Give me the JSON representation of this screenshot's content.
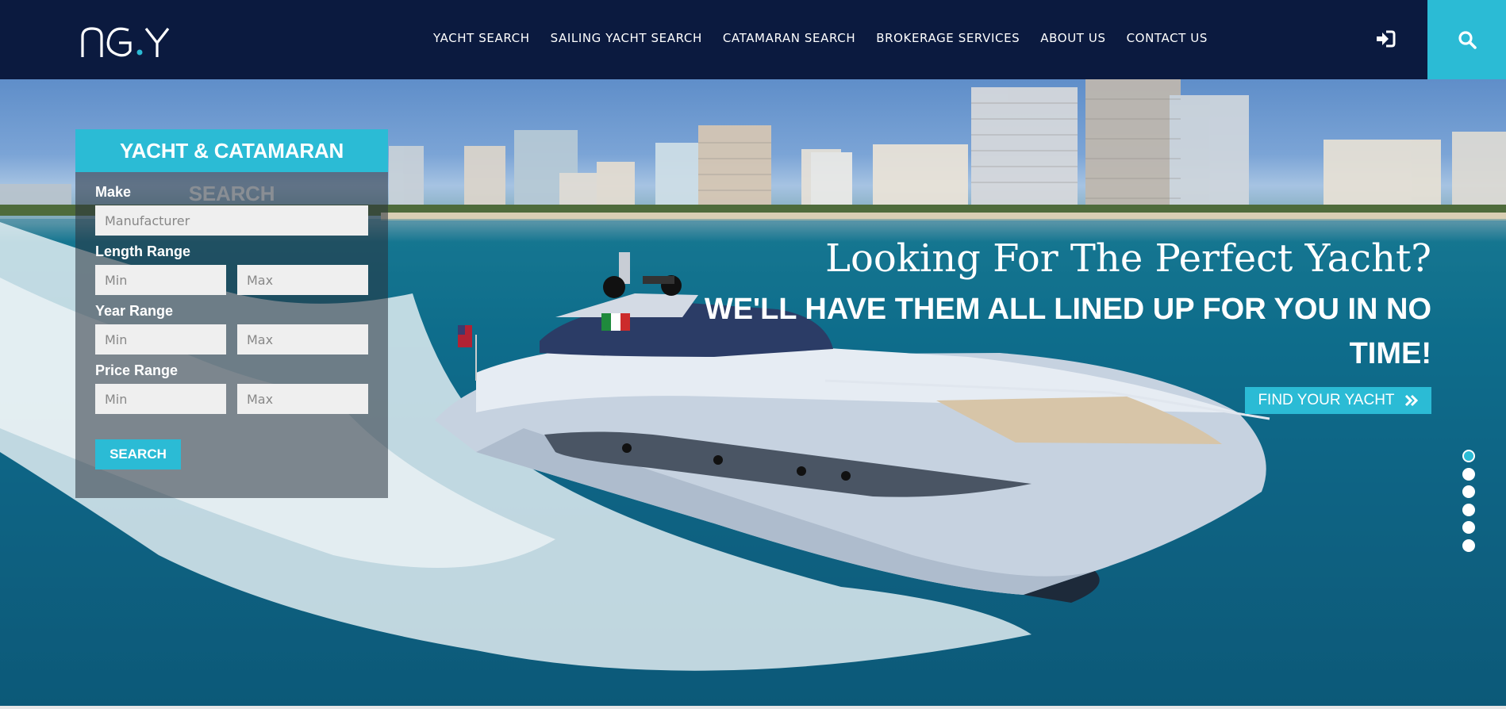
{
  "header": {
    "logo_text": "NGY",
    "nav": [
      {
        "label": "YACHT SEARCH"
      },
      {
        "label": "SAILING YACHT SEARCH"
      },
      {
        "label": "CATAMARAN SEARCH"
      },
      {
        "label": "BROKERAGE SERVICES"
      },
      {
        "label": "ABOUT US"
      },
      {
        "label": "CONTACT US"
      }
    ],
    "login_icon": "sign-in-icon",
    "search_icon": "search-icon"
  },
  "search_panel": {
    "title": "YACHT & CATAMARAN SEARCH",
    "make_label": "Make",
    "make_placeholder": "Manufacturer",
    "length_label": "Length Range",
    "year_label": "Year Range",
    "price_label": "Price Range",
    "min_placeholder": "Min",
    "max_placeholder": "Max",
    "submit_label": "SEARCH"
  },
  "hero": {
    "headline": "Looking For The Perfect Yacht?",
    "subheadline": "WE'LL HAVE THEM ALL LINED UP FOR YOU IN NO TIME!",
    "cta_label": "FIND YOUR YACHT",
    "cta_icon": "double-chevron-right-icon",
    "slide_count": 6,
    "active_slide": 1
  },
  "colors": {
    "header_bg": "#0b1a3f",
    "accent": "#2bbbd5"
  }
}
